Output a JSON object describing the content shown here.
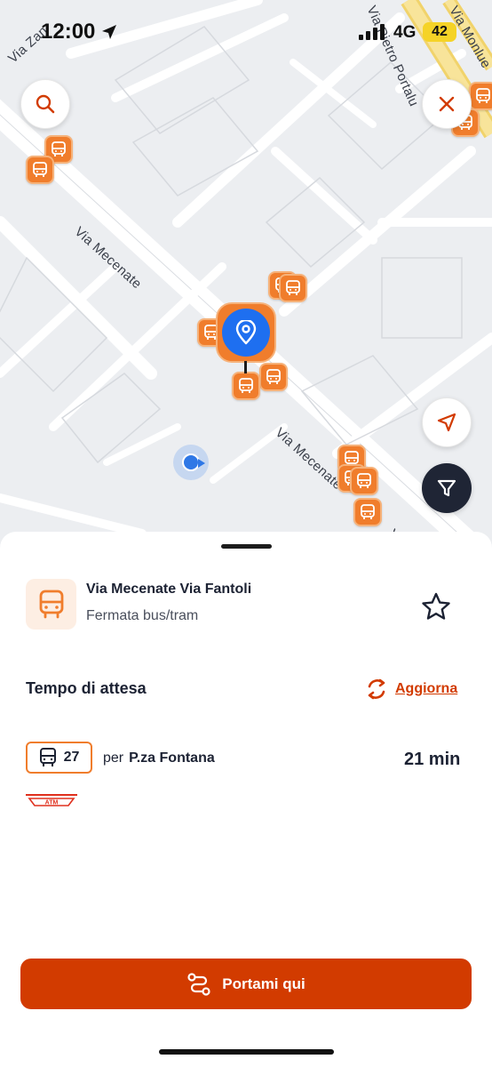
{
  "status_bar": {
    "time": "12:00",
    "network": "4G",
    "battery": "42"
  },
  "map": {
    "streets": [
      "Via Mecenate",
      "Via Mecenate",
      "Via Zan",
      "Via Pietro Portalu",
      "Via Monlue",
      "Via"
    ],
    "buttons": {
      "search": "search-icon",
      "close": "close-icon",
      "locate": "navigation-arrow-icon",
      "filter": "filter-icon"
    }
  },
  "stop": {
    "name": "Via Mecenate Via Fantoli",
    "type": "Fermata bus/tram"
  },
  "waiting": {
    "title": "Tempo di attesa",
    "refresh_label": "Aggiorna"
  },
  "arrivals": [
    {
      "line": "27",
      "prefix": "per",
      "destination": "P.za Fontana",
      "eta": "21 min",
      "operator": "ATM"
    }
  ],
  "cta": {
    "label": "Portami qui"
  },
  "colors": {
    "accent": "#d23b00",
    "marker": "#f07d2c",
    "selected": "#1e6ff0"
  }
}
